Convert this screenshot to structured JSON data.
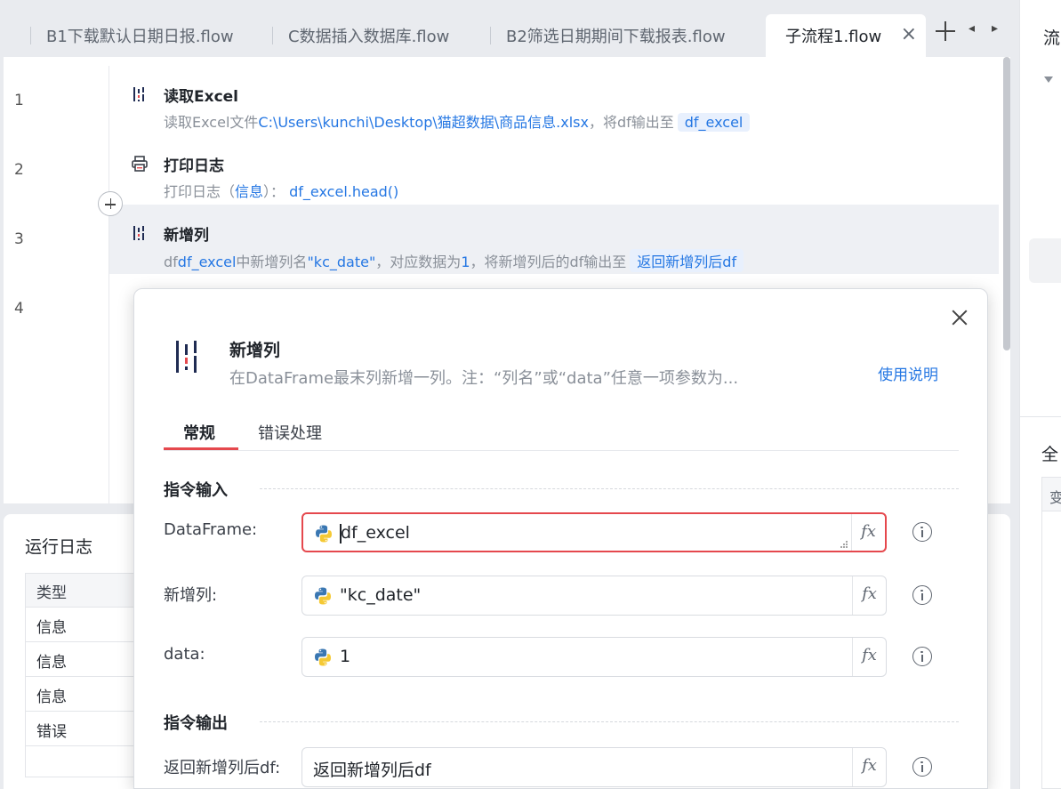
{
  "tabs": [
    {
      "label": "B1下载默认日期日报.flow"
    },
    {
      "label": "C数据插入数据库.flow"
    },
    {
      "label": "B2筛选日期期间下载报表.flow"
    },
    {
      "label": "子流程1.flow",
      "active": true
    }
  ],
  "tab_controls": {
    "prev": "◂",
    "next": "▸",
    "close": "×"
  },
  "line_numbers": [
    "1",
    "2",
    "3",
    "4"
  ],
  "steps": [
    {
      "title": "读取Excel",
      "desc_prefix": "读取Excel文件",
      "path": "C:\\Users\\kunchi\\Desktop\\猫超数据\\商品信息.xlsx",
      "desc_mid": "，将df输出至",
      "output_var": "df_excel",
      "icon": "dataframe-icon"
    },
    {
      "title": "打印日志",
      "desc_prefix": "打印日志（",
      "param": "信息",
      "desc_mid": "）：",
      "value": "df_excel.head()",
      "icon": "printer-icon"
    },
    {
      "title": "新增列",
      "desc_prefix": "df",
      "df_var": "df_excel",
      "desc_mid1": "中新增列名",
      "col_name": "\"kc_date\"",
      "desc_mid2": "，对应数据为",
      "data_val": "1",
      "desc_mid3": "，将新增列后的df输出至",
      "output_var": "返回新增列后df",
      "icon": "dataframe-icon"
    }
  ],
  "right_panel": {
    "title_top": "流",
    "title_bottom": "全",
    "table_header": "变"
  },
  "log": {
    "title": "运行日志",
    "header": "类型",
    "rows": [
      "信息",
      "信息",
      "信息",
      "错误"
    ]
  },
  "dialog": {
    "title": "新增列",
    "description": "在DataFrame最末列新增一列。注：“列名”或“data”任意一项参数为...",
    "help_link": "使用说明",
    "tabs": [
      "常规",
      "错误处理"
    ],
    "section_input": "指令输入",
    "section_output": "指令输出",
    "fields": {
      "dataframe": {
        "label": "DataFrame:",
        "value": "df_excel"
      },
      "new_column": {
        "label": "新增列:",
        "value": "\"kc_date\""
      },
      "data": {
        "label": "data:",
        "value": "1"
      },
      "output": {
        "label": "返回新增列后df:",
        "value": "返回新增列后df"
      }
    },
    "fx_label": "fx"
  },
  "colors": {
    "accent_blue": "#2577e3",
    "error_red": "#e5484d",
    "selected_row": "#eef0f4"
  }
}
